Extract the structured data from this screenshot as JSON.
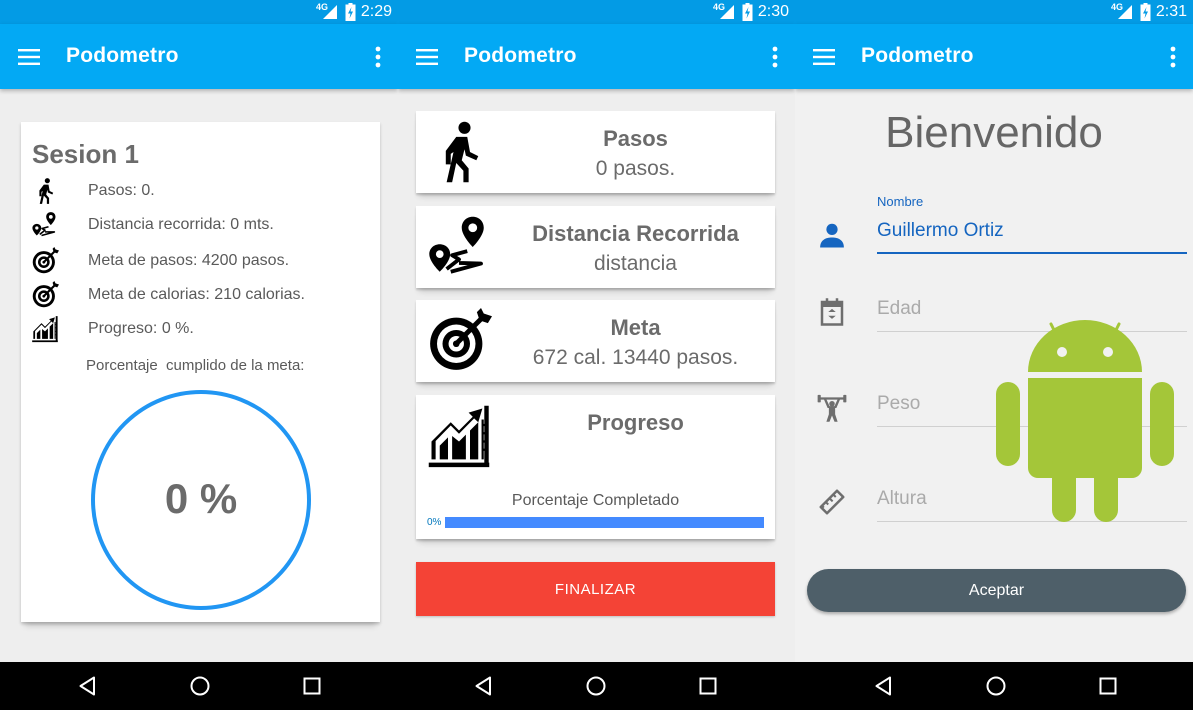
{
  "screens": [
    {
      "status_time": "2:29",
      "network": "4G",
      "app_title": "Podometro",
      "session": {
        "title": "Sesion 1",
        "stats": [
          {
            "icon": "walk-icon",
            "text": "Pasos: 0."
          },
          {
            "icon": "route-icon",
            "text": "Distancia recorrida: 0 mts."
          },
          {
            "icon": "target-icon",
            "text": "Meta de pasos: 4200 pasos."
          },
          {
            "icon": "target-icon",
            "text": "Meta de calorias: 210 calorias."
          },
          {
            "icon": "progress-chart-icon",
            "text": "Progreso: 0 %."
          }
        ],
        "percentage_label": "Porcentaje  cumplido de la meta:",
        "percentage_value": "0 %",
        "percentage_fraction": 0
      }
    },
    {
      "status_time": "2:30",
      "network": "4G",
      "app_title": "Podometro",
      "cards": [
        {
          "icon": "walk-icon",
          "title": "Pasos",
          "subtitle": "0 pasos."
        },
        {
          "icon": "route-icon",
          "title": "Distancia Recorrida",
          "subtitle": "distancia"
        },
        {
          "icon": "target-icon",
          "title": "Meta",
          "subtitle": "672 cal. 13440 pasos."
        },
        {
          "icon": "progress-chart-icon",
          "title": "Progreso",
          "subtitle": ""
        }
      ],
      "progress": {
        "label": "Porcentaje Completado",
        "percent_text": "0%",
        "bar_fill_fraction": 1.0
      },
      "finish_button": "FINALIZAR"
    },
    {
      "status_time": "2:31",
      "network": "4G",
      "app_title": "Podometro",
      "welcome": "Bienvenido",
      "form": {
        "name_label": "Nombre",
        "name_value": "Guillermo Ortiz",
        "age_placeholder": "Edad",
        "weight_placeholder": "Peso",
        "height_placeholder": "Altura"
      },
      "accept_button": "Aceptar"
    }
  ],
  "colors": {
    "status_bar": "#039be5",
    "app_bar": "#03a9f4",
    "circle": "#2196f3",
    "finish_button": "#f44336",
    "accept_button": "#4e5f69",
    "input_accent": "#1565c0",
    "android_green": "#a4c639"
  }
}
